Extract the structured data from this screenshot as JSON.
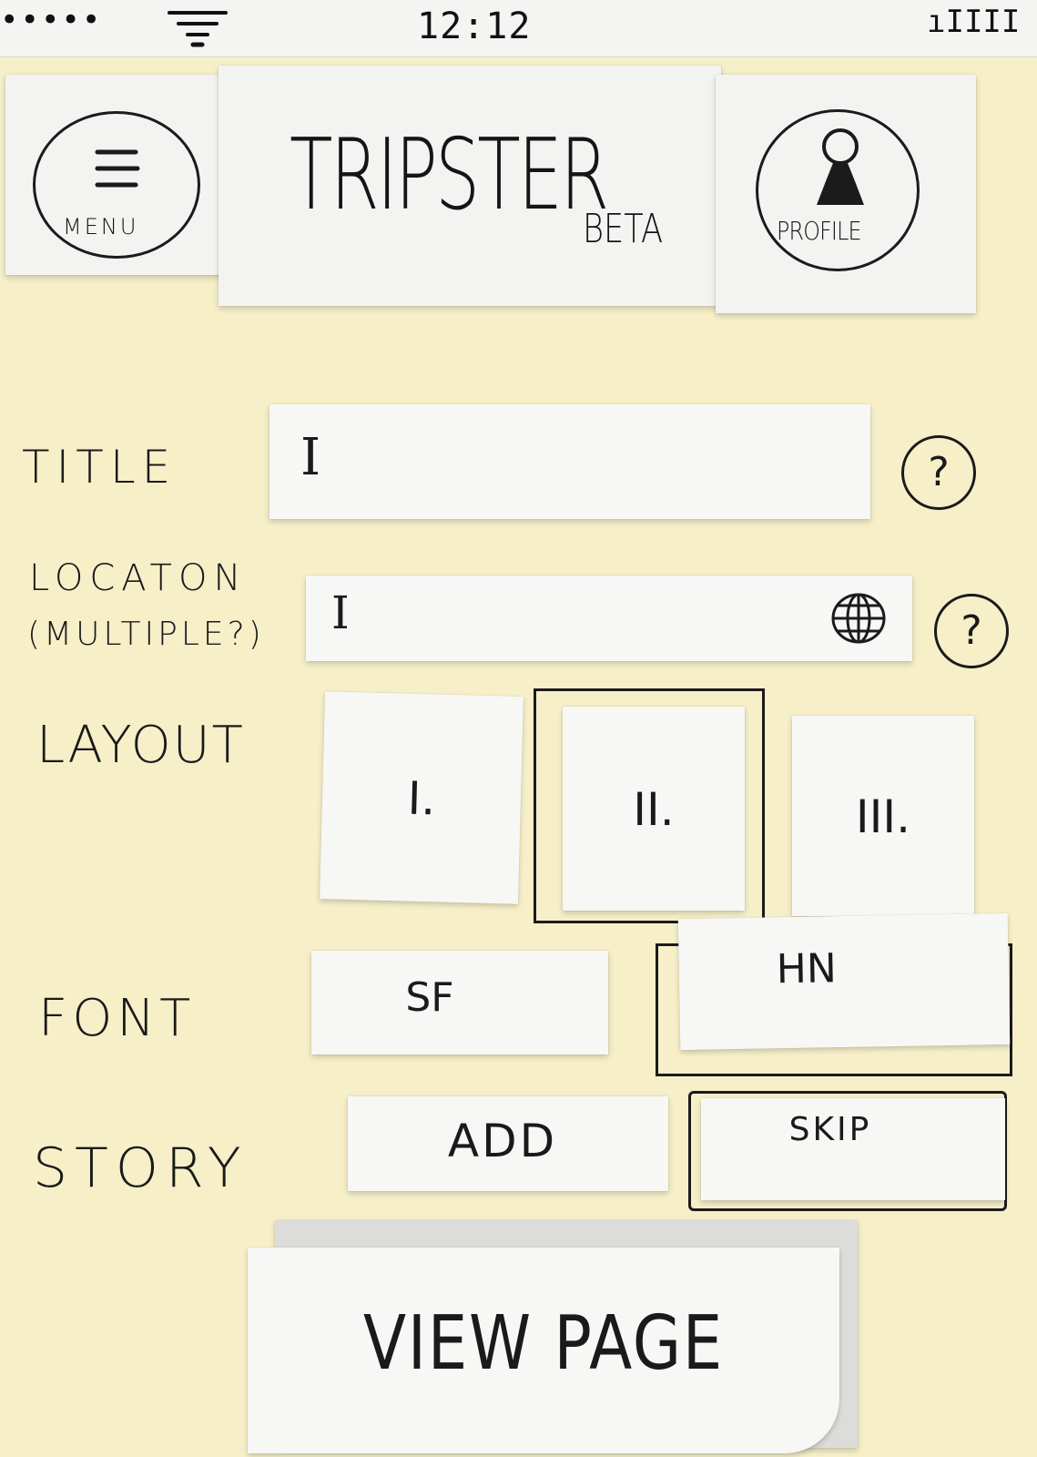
{
  "status_bar": {
    "signal_dots": "•••••",
    "time": "12:12",
    "battery": "ıIIII"
  },
  "header": {
    "menu_label": "MENU",
    "app_title": "TRIPSTER",
    "beta_label": "BETA",
    "profile_label": "PROFILE"
  },
  "form": {
    "title_label": "TITLE",
    "title_value": "I",
    "location_label_line1": "LOCATON",
    "location_label_line2": "(MULTIPLE?)",
    "location_value": "I",
    "help_glyph": "?",
    "layout_label": "LAYOUT",
    "layout_options": [
      "I.",
      "II.",
      "III."
    ],
    "layout_selected": "II.",
    "font_label": "FONT",
    "font_options": [
      "SF",
      "HN"
    ],
    "font_selected": "HN",
    "story_label": "STORY",
    "story_options": [
      "ADD",
      "SKIP"
    ],
    "story_selected": "SKIP"
  },
  "primary_action": {
    "label": "VIEW PAGE"
  }
}
